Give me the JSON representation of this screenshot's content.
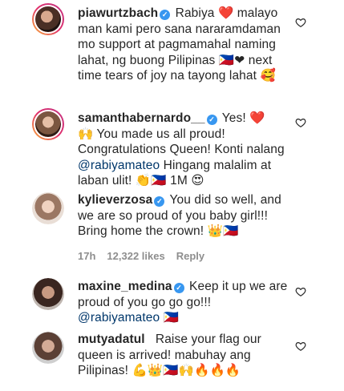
{
  "comments": [
    {
      "username": "piawurtzbach",
      "text_1": "Rabiya",
      "emoji_1": "❤️",
      "text_2": "malayo man kami pero sana nararamdaman mo support at pagmamahal naming lahat, ng buong Pilipinas",
      "emoji_2": "🇵🇭❤",
      "text_3": "next time tears of joy na tayong lahat",
      "emoji_3": "🥰"
    },
    {
      "username": "samanthabernardo__",
      "text_1": "Yes!",
      "emoji_1": "❤️",
      "emoji_2": "🙌",
      "text_2": "You made us all proud! Congratulations Queen! Konti nalang",
      "mention": "@rabiyamateo",
      "text_3": "Hingang malalim at laban ulit!",
      "emoji_3": "👏🇵🇭",
      "text_4": "1M",
      "emoji_4": "😍"
    },
    {
      "username": "kylieverzosa",
      "text_1": "You did so well, and we are so proud of you baby girl!!! Bring home the crown!",
      "emoji_1": "👑🇵🇭",
      "time": "17h",
      "likes": "12,322 likes",
      "reply": "Reply"
    },
    {
      "username": "maxine_medina",
      "text_1": "Keep it up we are proud of you go go go!!!",
      "mention": "@rabiyamateo",
      "emoji_1": "🇵🇭"
    },
    {
      "username": "mutyadatul",
      "text_1": "Raise your flag our queen is arrived! mabuhay ang Pilipinas!",
      "emoji_1": "💪👑🇵🇭🙌🔥🔥🔥"
    }
  ],
  "icons": {
    "heart": "heart-outline-icon",
    "verified": "verified-badge-icon"
  },
  "colors": {
    "mention": "#00376b",
    "verified": "#3897f0",
    "meta": "#8e8e8e"
  }
}
